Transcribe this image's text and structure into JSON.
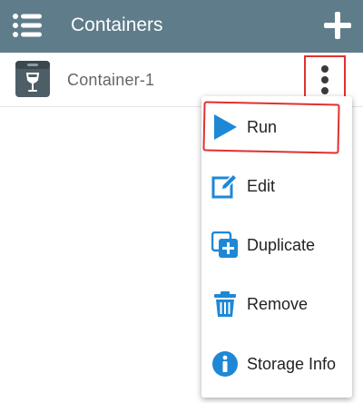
{
  "appbar": {
    "title": "Containers",
    "background": "#5f7c8a",
    "menu_icon": "hamburger-icon",
    "add_icon": "plus-icon"
  },
  "containers": [
    {
      "name": "Container-1",
      "icon": "wine-glass-box-icon"
    }
  ],
  "context_menu": {
    "items": [
      {
        "label": "Run",
        "icon": "play-icon"
      },
      {
        "label": "Edit",
        "icon": "edit-pencil-icon"
      },
      {
        "label": "Duplicate",
        "icon": "duplicate-icon"
      },
      {
        "label": "Remove",
        "icon": "trash-icon"
      },
      {
        "label": "Storage Info",
        "icon": "info-icon"
      }
    ]
  },
  "colors": {
    "accent_blue": "#1e88d6",
    "annotation_red": "#e0312e"
  }
}
